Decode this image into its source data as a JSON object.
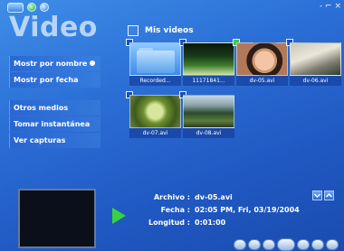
{
  "window": {
    "controls": "- ⌐ ×"
  },
  "app": {
    "title": "Video"
  },
  "menu": {
    "primary": [
      {
        "label": "Mostr por nombre",
        "selected": true
      },
      {
        "label": "Mostr por fecha",
        "selected": false
      }
    ],
    "secondary": [
      {
        "label": "Otros medios"
      },
      {
        "label": "Tomar instantánea"
      },
      {
        "label": "Ver capturas"
      }
    ]
  },
  "library": {
    "header": "Mis videos",
    "items": [
      {
        "caption": "Recorded...",
        "thumb": "folder",
        "checked": false
      },
      {
        "caption": "11171841...",
        "thumb": "forest",
        "checked": false
      },
      {
        "caption": "dv-05.avi",
        "thumb": "baby",
        "checked": true
      },
      {
        "caption": "dv-06.avi",
        "thumb": "sign",
        "checked": false
      },
      {
        "caption": "dv-07.avi",
        "thumb": "bush",
        "checked": false
      },
      {
        "caption": "dv-08.avi",
        "thumb": "tree",
        "checked": false
      }
    ]
  },
  "details": {
    "file_label": "Archivo :",
    "file_value": "dv-05.avi",
    "date_label": "Fecha :",
    "date_value": "02:05 PM, Fri, 03/19/2004",
    "length_label": "Longitud :",
    "length_value": "0:01:00"
  },
  "colors": {
    "accent_green": "#37d23f",
    "background": "#2b6fd6"
  }
}
